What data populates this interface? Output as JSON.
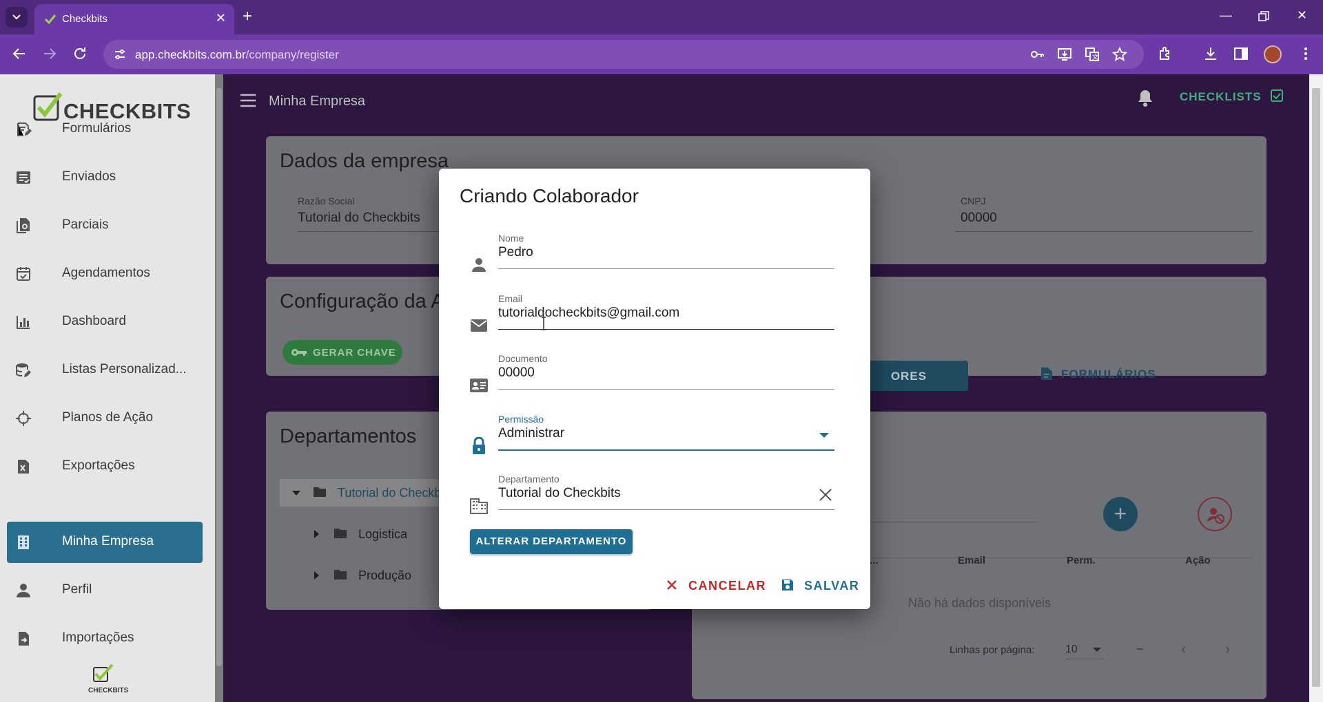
{
  "browser": {
    "tab_title": "Checkbits",
    "url_host": "app.checkbits.com.br",
    "url_path": "/company/register",
    "chrome_color": "#6b3aa6"
  },
  "sidebar": {
    "logo_text": "CHECKBITS",
    "footer_logo_text": "CHECKBITS",
    "items": [
      {
        "label": "Formulários",
        "icon": "form-edit-icon"
      },
      {
        "label": "Enviados",
        "icon": "sent-list-icon"
      },
      {
        "label": "Parciais",
        "icon": "partial-docs-icon"
      },
      {
        "label": "Agendamentos",
        "icon": "calendar-check-icon"
      },
      {
        "label": "Dashboard",
        "icon": "bar-chart-icon"
      },
      {
        "label": "Listas Personalizad...",
        "icon": "database-edit-icon"
      },
      {
        "label": "Planos de Ação",
        "icon": "crosshair-icon"
      },
      {
        "label": "Exportações",
        "icon": "excel-file-icon"
      },
      {
        "label": "Minha Empresa",
        "icon": "building-icon",
        "active": true
      },
      {
        "label": "Perfil",
        "icon": "person-icon"
      },
      {
        "label": "Importações",
        "icon": "file-import-icon"
      }
    ]
  },
  "appbar": {
    "title": "Minha Empresa",
    "checklists_label": "CHECKLISTS"
  },
  "company_card": {
    "title": "Dados da empresa",
    "razao_label": "Razão Social",
    "razao_value": "Tutorial do Checkbits",
    "cnpj_label": "CNPJ",
    "cnpj_value": "00000"
  },
  "config_card": {
    "title": "Configuração da A",
    "gerar_label": "GERAR CHAVE"
  },
  "departments_card": {
    "title": "Departamentos",
    "tree": [
      {
        "label": "Tutorial do Checkb",
        "level": 0,
        "expanded": true
      },
      {
        "label": "Logistica",
        "level": 1
      },
      {
        "label": "Produção",
        "level": 1
      }
    ]
  },
  "collab_panel": {
    "tab_colaboradores": "ORES",
    "tab_formularios": "FORMULÁRIOS",
    "col_name_fragment": "...",
    "col_email": "Email",
    "col_perm": "Perm.",
    "col_acao": "Ação",
    "empty": "Não há dados disponíveis",
    "rows_per_page_label": "Linhas por página:",
    "rows_per_page_value": "10",
    "range": "–"
  },
  "dialog": {
    "title": "Criando Colaborador",
    "fields": {
      "nome": {
        "label": "Nome",
        "value": "Pedro"
      },
      "email": {
        "label": "Email",
        "value": "tutorialdocheckbits@gmail.com"
      },
      "documento": {
        "label": "Documento",
        "value": "00000"
      },
      "permissao": {
        "label": "Permissão",
        "value": "Administrar"
      },
      "departamento": {
        "label": "Departamento",
        "value": "Tutorial do Checkbits"
      }
    },
    "alterar_label": "ALTERAR DEPARTAMENTO",
    "cancel_label": "CANCELAR",
    "save_label": "SALVAR",
    "accent": "#1f6f94",
    "danger": "#c62828"
  }
}
